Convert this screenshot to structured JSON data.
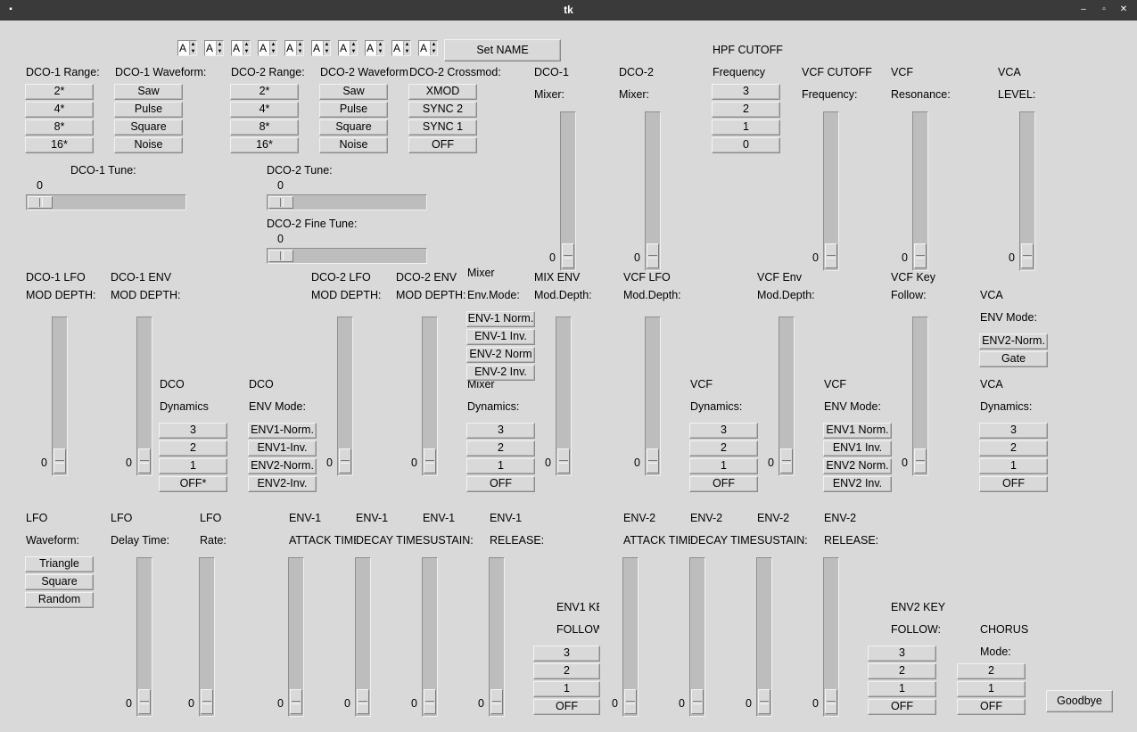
{
  "window": {
    "title": "tk"
  },
  "char_spinners": [
    "A",
    "A",
    "A",
    "A",
    "A",
    "A",
    "A",
    "A",
    "A",
    "A"
  ],
  "set_name_label": "Set NAME",
  "goodbye_label": "Goodbye",
  "labels": {
    "dco1_range": "DCO-1 Range:",
    "dco1_wave": "DCO-1 Waveform:",
    "dco2_range": "DCO-2 Range:",
    "dco2_wave": "DCO-2 Waveform:",
    "dco2_xmod": "DCO-2 Crossmod:",
    "dco1_mix_a": "DCO-1",
    "dco1_mix_b": "Mixer:",
    "dco2_mix_a": "DCO-2",
    "dco2_mix_b": "Mixer:",
    "hpf_a": "HPF CUTOFF",
    "hpf_b": "Frequency",
    "vcf_cut_a": "VCF CUTOFF",
    "vcf_cut_b": "Frequency:",
    "vcf_res_a": "VCF",
    "vcf_res_b": "Resonance:",
    "vca_lvl_a": "VCA",
    "vca_lvl_b": "LEVEL:",
    "dco1_tune": "DCO-1 Tune:",
    "dco2_tune": "DCO-2 Tune:",
    "dco2_fine": "DCO-2 Fine Tune:",
    "dco1_lfo_a": "DCO-1 LFO",
    "dco1_lfo_b": "MOD DEPTH:",
    "dco1_env_a": "DCO-1 ENV",
    "dco1_env_b": "MOD DEPTH:",
    "dco2_lfo_a": "DCO-2 LFO",
    "dco2_lfo_b": "MOD DEPTH:",
    "dco2_env_a": "DCO-2 ENV",
    "dco2_env_b": "MOD DEPTH:",
    "mix_envmode_a": "Mixer",
    "mix_envmode_b": "Env.Mode:",
    "mixenv_a": "MIX ENV",
    "mixenv_b": "Mod.Depth:",
    "vcf_lfo_a": "VCF LFO",
    "vcf_lfo_b": "Mod.Depth:",
    "vcf_env_a": "VCF Env",
    "vcf_env_b": "Mod.Depth:",
    "vcf_key_a": "VCF Key",
    "vcf_key_b": "Follow:",
    "vca_envmode_a": "VCA",
    "vca_envmode_b": "ENV Mode:",
    "dco_dyn_a": "DCO",
    "dco_dyn_b": "Dynamics",
    "dco_envmode_a": "DCO",
    "dco_envmode_b": "ENV Mode:",
    "mix_dyn_a": "Mixer",
    "mix_dyn_b": "Dynamics:",
    "vcf_dyn_a": "VCF",
    "vcf_dyn_b": "Dynamics:",
    "vcf_envmode_a": "VCF",
    "vcf_envmode_b": "ENV Mode:",
    "vca_dyn_a": "VCA",
    "vca_dyn_b": "Dynamics:",
    "lfo_wave_a": "LFO",
    "lfo_wave_b": "Waveform:",
    "lfo_delay_a": "LFO",
    "lfo_delay_b": "Delay Time:",
    "lfo_rate_a": "LFO",
    "lfo_rate_b": "Rate:",
    "env1_att_a": "ENV-1",
    "env1_att_b": "ATTACK TIME",
    "env1_dec_a": "ENV-1",
    "env1_dec_b": "DECAY TIME",
    "env1_sus_a": "ENV-1",
    "env1_sus_b": "SUSTAIN:",
    "env1_rel_a": "ENV-1",
    "env1_rel_b": "RELEASE:",
    "env2_att_a": "ENV-2",
    "env2_att_b": "ATTACK TIME",
    "env2_dec_a": "ENV-2",
    "env2_dec_b": "DECAY TIME",
    "env2_sus_a": "ENV-2",
    "env2_sus_b": "SUSTAIN:",
    "env2_rel_a": "ENV-2",
    "env2_rel_b": "RELEASE:",
    "env1key_a": "ENV1 KEY",
    "env1key_b": "FOLLOW:",
    "env2key_a": "ENV2 KEY",
    "env2key_b": "FOLLOW:",
    "chorus_a": "CHORUS",
    "chorus_b": "Mode:"
  },
  "buttons": {
    "dco1_range": [
      "2*",
      "4*",
      "8*",
      "16*"
    ],
    "dco1_wave": [
      "Saw",
      "Pulse",
      "Square",
      "Noise"
    ],
    "dco2_range": [
      "2*",
      "4*",
      "8*",
      "16*"
    ],
    "dco2_wave": [
      "Saw",
      "Pulse",
      "Square",
      "Noise"
    ],
    "dco2_xmod": [
      "XMOD",
      "SYNC 2",
      "SYNC 1",
      "OFF"
    ],
    "hpf": [
      "3",
      "2",
      "1",
      "0"
    ],
    "mix_envmode": [
      "ENV-1 Norm.",
      "ENV-1 Inv.",
      "ENV-2 Norm",
      "ENV-2 Inv."
    ],
    "vca_envmode": [
      "ENV2-Norm.",
      "Gate"
    ],
    "dco_dyn": [
      "3",
      "2",
      "1",
      "OFF*"
    ],
    "dco_envmode": [
      "ENV1-Norm.",
      "ENV1-Inv.",
      "ENV2-Norm.",
      "ENV2-Inv."
    ],
    "mix_dyn": [
      "3",
      "2",
      "1",
      "OFF"
    ],
    "vcf_dyn": [
      "3",
      "2",
      "1",
      "OFF"
    ],
    "vcf_envmode": [
      "ENV1 Norm.",
      "ENV1 Inv.",
      "ENV2 Norm.",
      "ENV2 Inv."
    ],
    "vca_dyn": [
      "3",
      "2",
      "1",
      "OFF"
    ],
    "lfo_wave": [
      "Triangle",
      "Square",
      "Random"
    ],
    "env1key": [
      "3",
      "2",
      "1",
      "OFF"
    ],
    "env2key": [
      "3",
      "2",
      "1",
      "OFF"
    ],
    "chorus": [
      "2",
      "1",
      "OFF"
    ]
  },
  "sliders": {
    "dco1_mix": "0",
    "dco2_mix": "0",
    "vcf_cut": "0",
    "vcf_res": "0",
    "vca_lvl": "0",
    "dco1_tune": "0",
    "dco2_tune": "0",
    "dco2_fine": "0",
    "dco1_lfo": "0",
    "dco1_env": "0",
    "dco2_lfo": "0",
    "dco2_env": "0",
    "mixenv": "0",
    "vcf_lfo": "0",
    "vcf_env": "0",
    "vcf_key": "0",
    "lfo_delay": "0",
    "lfo_rate": "0",
    "env1_att": "0",
    "env1_dec": "0",
    "env1_sus": "0",
    "env1_rel": "0",
    "env2_att": "0",
    "env2_dec": "0",
    "env2_sus": "0",
    "env2_rel": "0"
  }
}
